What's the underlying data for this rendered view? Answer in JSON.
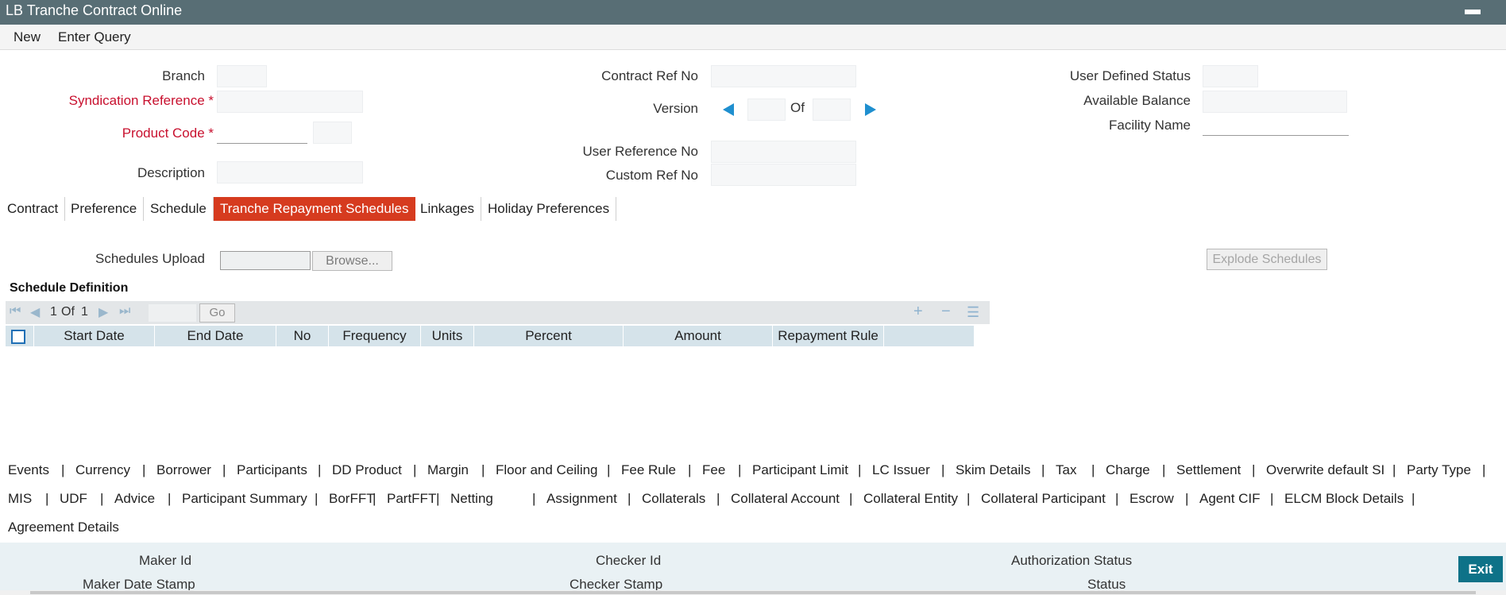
{
  "window": {
    "title": "LB Tranche Contract Online",
    "minimize_glyph": "▬"
  },
  "toolbar": {
    "new_label": "New",
    "enter_query_label": "Enter Query"
  },
  "form": {
    "branch_label": "Branch",
    "syndication_ref_label": "Syndication Reference *",
    "product_code_label": "Product Code *",
    "description_label": "Description",
    "contract_ref_label": "Contract Ref No",
    "version_label": "Version",
    "of_label": "Of",
    "user_ref_label": "User Reference No",
    "custom_ref_label": "Custom Ref No",
    "user_defined_status_label": "User Defined Status",
    "available_balance_label": "Available Balance",
    "facility_name_label": "Facility Name"
  },
  "tabs": [
    {
      "label": "Contract"
    },
    {
      "label": "Preference"
    },
    {
      "label": "Schedule"
    },
    {
      "label": "Tranche Repayment Schedules"
    },
    {
      "label": "Linkages"
    },
    {
      "label": "Holiday Preferences"
    }
  ],
  "schedules": {
    "upload_label": "Schedules Upload",
    "browse_label": "Browse...",
    "explode_label": "Explode Schedules",
    "section_title": "Schedule Definition",
    "pager": {
      "current": "1",
      "of_label": "Of",
      "total": "1",
      "go_label": "Go"
    },
    "columns": [
      "Start Date",
      "End Date",
      "No",
      "Frequency",
      "Units",
      "Percent",
      "Amount",
      "Repayment Rule"
    ]
  },
  "links_row1": [
    "Events",
    "Currency",
    "Borrower",
    "Participants",
    "DD Product",
    "Margin",
    "Floor and Ceiling",
    "Fee Rule",
    "Fee",
    "Participant Limit",
    "LC Issuer",
    "Skim Details",
    "Tax",
    "Charge",
    "Settlement",
    "Overwrite default SI",
    "Party Type"
  ],
  "links_row2": [
    "MIS",
    "UDF",
    "Advice",
    "Participant Summary",
    "BorFFT",
    "PartFFT",
    "Netting",
    "Assignment",
    "Collaterals",
    "Collateral Account",
    "Collateral Entity",
    "Collateral Participant",
    "Escrow",
    "Agent CIF",
    "ELCM Block Details"
  ],
  "links_row3": [
    "Agreement Details"
  ],
  "separator": "|",
  "footer": {
    "maker_id": "Maker Id",
    "maker_date": "Maker Date Stamp",
    "checker_id": "Checker Id",
    "checker_stamp": "Checker Stamp",
    "auth_status": "Authorization Status",
    "status": "Status",
    "exit_label": "Exit"
  },
  "colors": {
    "titlebar": "#586e75",
    "active_tab": "#d63b1f",
    "accent_blue": "#1f8fcf",
    "exit_button": "#0e7288",
    "required": "#c8102e"
  }
}
